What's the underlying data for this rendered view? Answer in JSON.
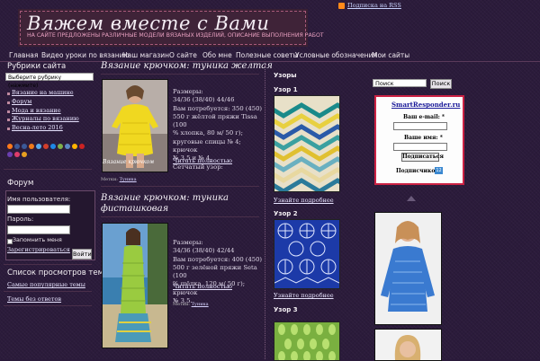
{
  "header": {
    "site_title": "Вяжем вместе с Вами",
    "tagline": "НА САЙТЕ ПРЕДЛОЖЕНЫ РАЗЛИЧНЫЕ МОДЕЛИ ВЯЗАНЫХ ИЗДЕЛИЙ, ОПИСАНИЕ ВЫПОЛНЕНИЯ РАБОТ",
    "rss_label": "Подписка на RSS"
  },
  "nav": {
    "items": [
      "Главная",
      "Видео уроки по вязанию",
      "Наш магазин",
      "О сайте",
      "Обо мне",
      "Полезные советы",
      "Условные обозначения",
      "Мои сайты"
    ]
  },
  "sidebar": {
    "rubrics_title": "Рубрики сайта",
    "rubrics_select": "Выберите рубрику (нажмите)",
    "links": [
      "Вязание на машине",
      "Форум",
      "Мода и вязание",
      "Журналы по вязанию",
      "Весна-лето 2016"
    ],
    "forum_title": "Форум",
    "username_label": "Имя пользователя:",
    "password_label": "Пароль:",
    "remember_label": "Запомнить меня",
    "login_button": "Войти",
    "register_link": "Зарегистрироваться",
    "topics_title": "Список просмотров тем",
    "popular_link": "Самые популярные темы",
    "no_answers_link": "Темы без ответов"
  },
  "posts": [
    {
      "title": "Вязание крючком: туника желтая",
      "text_lines": [
        "Размеры:",
        "34/36 (38/40) 44/46",
        "Вам потребуется: 350 (450)",
        "550 г жёлтой пряжи Tissa (100",
        "% хлопка, 80 м/ 50 г);",
        "круговые спицы № 4; крючок",
        "№ 3,5 и № 4.",
        "Сетчатый узор:"
      ],
      "read_more": "Читать полностью",
      "meta_label": "Метки:",
      "meta_tag": "Туника",
      "image_caption": "Вязание крючком"
    },
    {
      "title_lines": [
        "Вязание крючком: туника",
        "фисташковая"
      ],
      "text_lines": [
        "Размеры:",
        "34/36 (38/40) 42/44",
        "Вам потребуется: 400 (450)",
        "500 г зелёной пряжи Seta (100",
        "% шёлка, 120 м/ 50 г); крючок",
        "№ 3,5."
      ],
      "read_more": "Читать полностью",
      "meta_label": "Метки:",
      "meta_tag": "Туника"
    }
  ],
  "patterns": {
    "section_title": "Узоры",
    "items": [
      {
        "title": "Узор 1",
        "link": "Узнайте подробнее"
      },
      {
        "title": "Узор 2",
        "link": "Узнайте подробнее"
      },
      {
        "title": "Узор 3"
      }
    ]
  },
  "right": {
    "search_value": "Поиск",
    "search_button": "Поиск",
    "subscribe": {
      "title": "SmartResponder.ru",
      "email_label": "Ваш e-mail: *",
      "name_label": "Ваше имя: *",
      "button": "Подписаться",
      "subscribers_label": "Подписчиков:",
      "subscribers_count": "12"
    }
  },
  "colors": {
    "background": "#2b1b3b",
    "accent": "#cc2244",
    "link": "#e8e4ff",
    "rss": "#ff8a1a"
  }
}
